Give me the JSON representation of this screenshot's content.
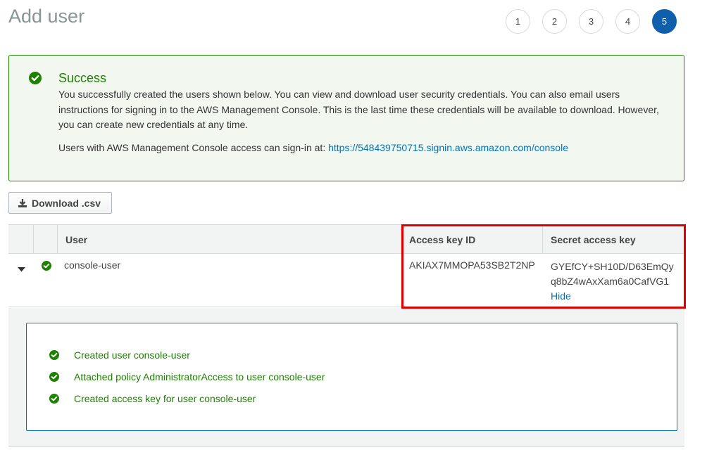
{
  "page": {
    "title": "Add user"
  },
  "steps": [
    "1",
    "2",
    "3",
    "4",
    "5"
  ],
  "active_step": "5",
  "success": {
    "title": "Success",
    "body": "You successfully created the users shown below. You can view and download user security credentials. You can also email users instructions for signing in to the AWS Management Console. This is the last time these credentials will be available to download. However, you can create new credentials at any time.",
    "signin_prefix": "Users with AWS Management Console access can sign-in at:",
    "signin_url": "https://548439750715.signin.aws.amazon.com/console"
  },
  "toolbar": {
    "download_label": "Download .csv"
  },
  "table": {
    "headers": {
      "user": "User",
      "access_key_id": "Access key ID",
      "secret_access_key": "Secret access key"
    },
    "rows": [
      {
        "user": "console-user",
        "access_key_id": "AKIAX7MMOPA53SB2T2NP",
        "secret_line1": "GYEfCY+SH10D/D63EmQy",
        "secret_line2": "q8bZ4wAxXam6a0CafVG1",
        "hide_label": "Hide"
      }
    ]
  },
  "results": [
    "Created user console-user",
    "Attached policy AdministratorAccess to user console-user",
    "Created access key for user console-user"
  ],
  "colors": {
    "success": "#1d8102",
    "link": "#0073bb",
    "active_step": "#0f5fad",
    "highlight": "#e00000"
  }
}
